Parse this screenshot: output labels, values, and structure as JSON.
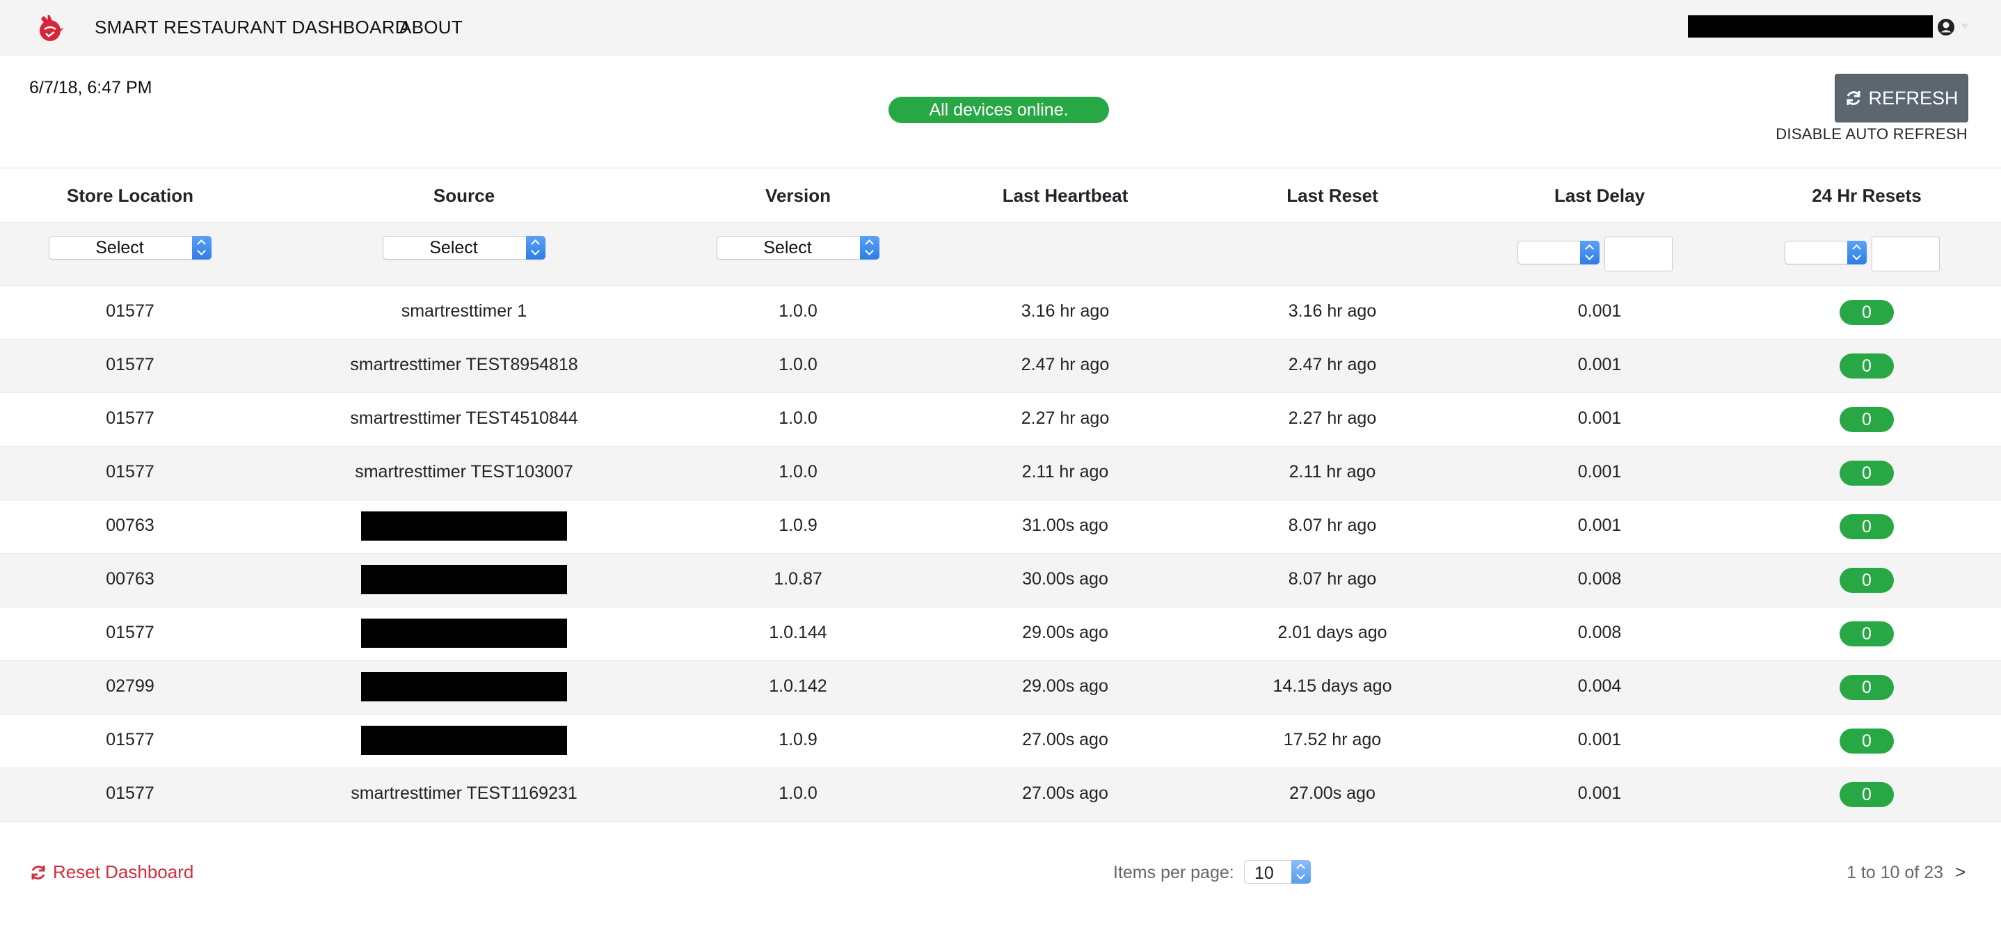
{
  "navbar": {
    "title": "SMART RESTAURANT DASHBOARD",
    "about": "ABOUT",
    "logo": "rooster-logo-icon",
    "user_icon": "user-circle-icon"
  },
  "header": {
    "timestamp": "6/7/18, 6:47 PM",
    "status": "All devices online.",
    "refresh_label": "REFRESH",
    "auto_refresh_label": "DISABLE AUTO REFRESH"
  },
  "table": {
    "columns": [
      "Store Location",
      "Source",
      "Version",
      "Last Heartbeat",
      "Last Reset",
      "Last Delay",
      "24 Hr Resets"
    ],
    "filters": {
      "store_location": "Select",
      "source": "Select",
      "version": "Select",
      "last_delay_op": "",
      "last_delay_val": "",
      "resets_op": "",
      "resets_val": ""
    },
    "rows": [
      {
        "store": "01577",
        "source": "smartresttimer 1",
        "source_redacted": false,
        "version": "1.0.0",
        "heartbeat": "3.16 hr ago",
        "reset": "3.16 hr ago",
        "delay": "0.001",
        "resets": "0"
      },
      {
        "store": "01577",
        "source": "smartresttimer TEST8954818",
        "source_redacted": false,
        "version": "1.0.0",
        "heartbeat": "2.47 hr ago",
        "reset": "2.47 hr ago",
        "delay": "0.001",
        "resets": "0"
      },
      {
        "store": "01577",
        "source": "smartresttimer TEST4510844",
        "source_redacted": false,
        "version": "1.0.0",
        "heartbeat": "2.27 hr ago",
        "reset": "2.27 hr ago",
        "delay": "0.001",
        "resets": "0"
      },
      {
        "store": "01577",
        "source": "smartresttimer TEST103007",
        "source_redacted": false,
        "version": "1.0.0",
        "heartbeat": "2.11 hr ago",
        "reset": "2.11 hr ago",
        "delay": "0.001",
        "resets": "0"
      },
      {
        "store": "00763",
        "source": "",
        "source_redacted": true,
        "version": "1.0.9",
        "heartbeat": "31.00s ago",
        "reset": "8.07 hr ago",
        "delay": "0.001",
        "resets": "0"
      },
      {
        "store": "00763",
        "source": "",
        "source_redacted": true,
        "version": "1.0.87",
        "heartbeat": "30.00s ago",
        "reset": "8.07 hr ago",
        "delay": "0.008",
        "resets": "0"
      },
      {
        "store": "01577",
        "source": "",
        "source_redacted": true,
        "version": "1.0.144",
        "heartbeat": "29.00s ago",
        "reset": "2.01 days ago",
        "delay": "0.008",
        "resets": "0"
      },
      {
        "store": "02799",
        "source": "",
        "source_redacted": true,
        "version": "1.0.142",
        "heartbeat": "29.00s ago",
        "reset": "14.15 days ago",
        "delay": "0.004",
        "resets": "0"
      },
      {
        "store": "01577",
        "source": "",
        "source_redacted": true,
        "version": "1.0.9",
        "heartbeat": "27.00s ago",
        "reset": "17.52 hr ago",
        "delay": "0.001",
        "resets": "0"
      },
      {
        "store": "01577",
        "source": "smartresttimer TEST1169231",
        "source_redacted": false,
        "version": "1.0.0",
        "heartbeat": "27.00s ago",
        "reset": "27.00s ago",
        "delay": "0.001",
        "resets": "0"
      }
    ]
  },
  "footer": {
    "reset_dashboard": "Reset Dashboard",
    "items_per_page_label": "Items per page:",
    "items_per_page_value": "10",
    "range_label": "1 to 10 of 23",
    "next_label": ">"
  },
  "colors": {
    "accent_green": "#28a745",
    "brand_red": "#d02f3b",
    "refresh_button": "#5b666f"
  }
}
